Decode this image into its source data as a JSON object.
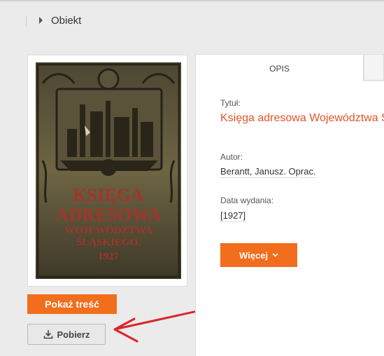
{
  "breadcrumb": {
    "label": "Obiekt"
  },
  "cover": {
    "title_line1": "KSIĘGA",
    "title_line2": "ADRESOWA",
    "title_line3": "WOJEWÓDZTWA",
    "title_line4": "ŚLĄSKIEGO.",
    "year": "1927"
  },
  "actions": {
    "show_content_label": "Pokaż treść",
    "download_label": "Pobierz"
  },
  "tabs": [
    {
      "label": "OPIS",
      "active": true
    },
    {
      "label": "",
      "active": false
    }
  ],
  "details": {
    "title_label": "Tytuł:",
    "title_value": "Księga adresowa Województwa Śląskiego",
    "author_label": "Autor:",
    "author_value": "Berantt, Janusz. Oprac.",
    "date_label": "Data wydania:",
    "date_value": "[1927]",
    "more_label": "Więcej"
  },
  "colors": {
    "accent": "#f26d1c",
    "title": "#e4532a",
    "annotation_arrow": "#d8262b"
  },
  "icons": [
    "chevron-right-icon",
    "download-icon",
    "chevron-down-icon"
  ]
}
